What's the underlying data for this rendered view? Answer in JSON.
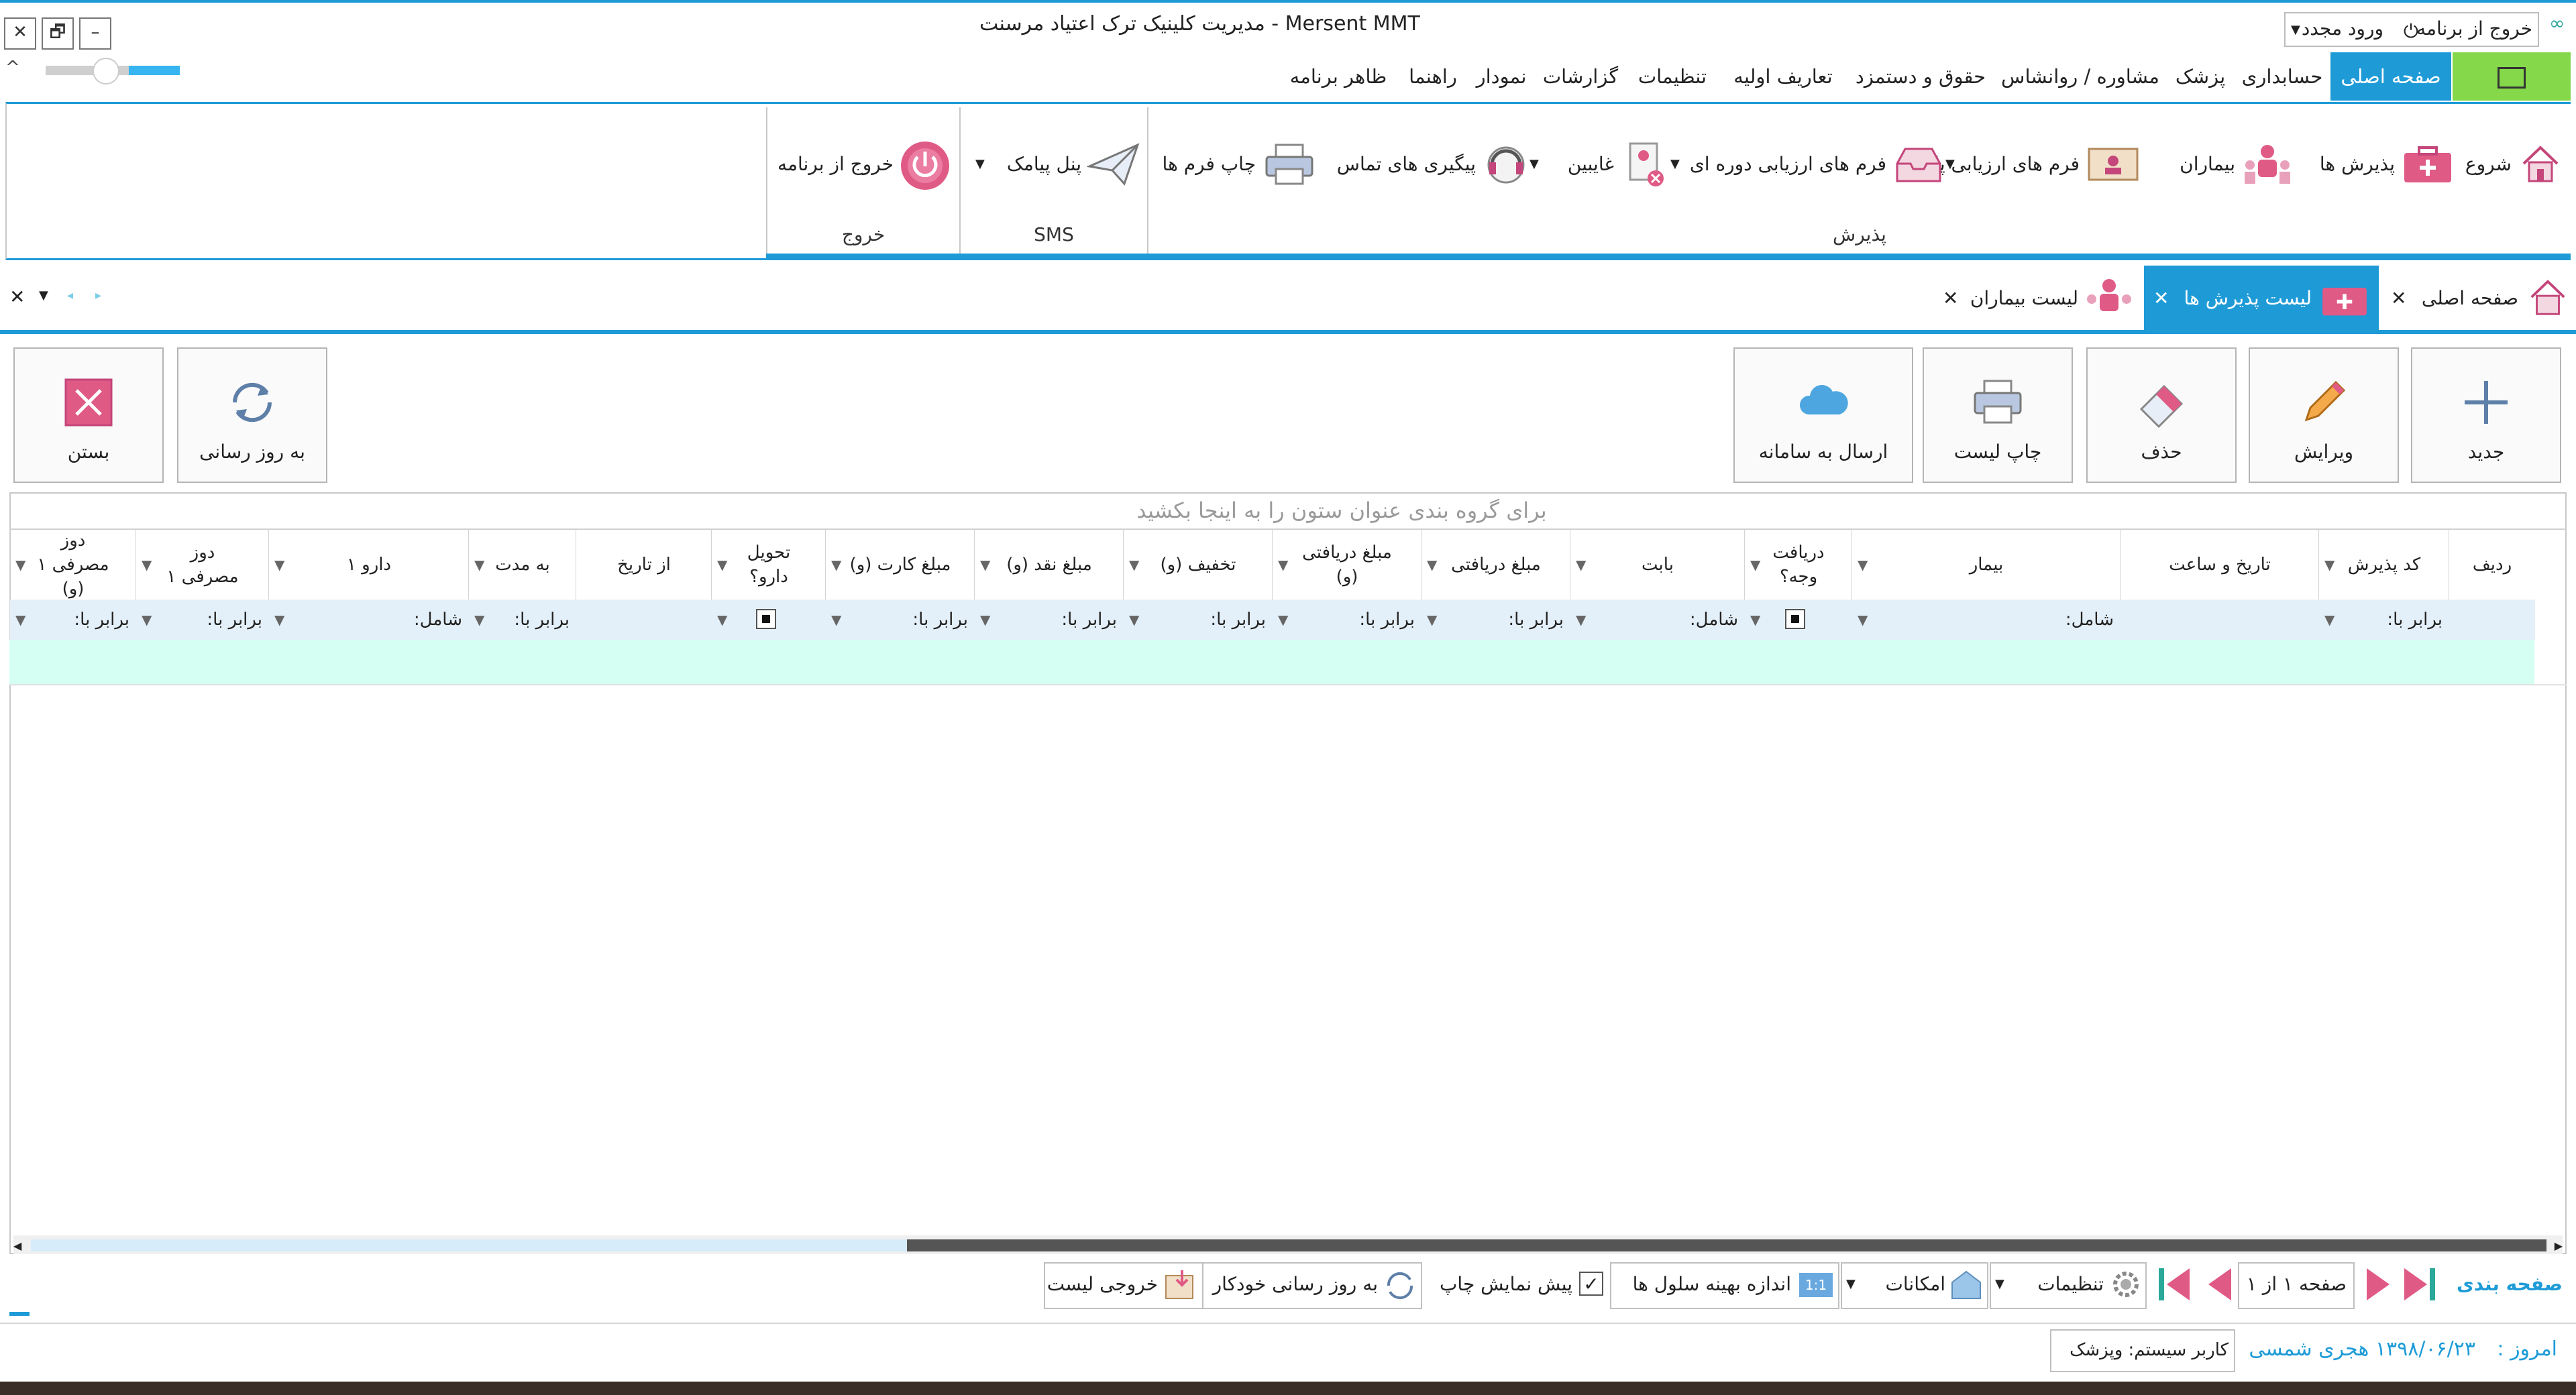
{
  "window": {
    "title": "مدیریت کلینیک ترک اعتیاد مرسنت - Mersent MMT",
    "exit_label": "خروج از برنامه",
    "relogin_label": "ورود مجدد"
  },
  "menu": {
    "tabs": [
      {
        "label": "صفحه اصلی",
        "active": true
      },
      {
        "label": "حسابداری"
      },
      {
        "label": "پزشک"
      },
      {
        "label": "مشاوره / روانشاس"
      },
      {
        "label": "حقوق و دستمزد"
      },
      {
        "label": "تعاریف اولیه"
      },
      {
        "label": "تنظیمات"
      },
      {
        "label": "گزارشات"
      },
      {
        "label": "نمودار"
      },
      {
        "label": "راهنما"
      },
      {
        "label": "ظاهر برنامه"
      }
    ]
  },
  "ribbon": {
    "items": [
      {
        "label": "شروع",
        "icon": "house-icon"
      },
      {
        "label": "پذیرش ها",
        "icon": "medical-case-icon"
      },
      {
        "label": "بیماران",
        "icon": "patients-icon"
      },
      {
        "label": "فرم های ارزیابی پایه",
        "icon": "form-icon"
      },
      {
        "label": "فرم های ارزیابی دوره ای",
        "icon": "inbox-icon"
      },
      {
        "label": "غایبین",
        "icon": "absent-icon"
      },
      {
        "label": "پیگیری های تماس",
        "icon": "headset-icon"
      },
      {
        "label": "چاپ فرم ها",
        "icon": "printer-icon"
      },
      {
        "label": "پنل پیامک",
        "icon": "paper-plane-icon"
      },
      {
        "label": "خروج از برنامه",
        "icon": "power-icon"
      }
    ],
    "groups": {
      "reception": "پذیرش",
      "sms": "SMS",
      "exit": "خروج"
    }
  },
  "doc_tabs": [
    {
      "label": "صفحه اصلی"
    },
    {
      "label": "لیست پذیرش ها",
      "active": true
    },
    {
      "label": "لیست بیماران"
    }
  ],
  "toolbar": {
    "new": "جدید",
    "edit": "ویرایش",
    "delete": "حذف",
    "print_list": "چاپ لیست",
    "send": "ارسال به سامانه",
    "refresh": "به روز رسانی",
    "close": "بستن"
  },
  "grid": {
    "group_hint": "برای گروه بندی عنوان ستون را به اینجا بکشید",
    "columns": [
      "ردیف",
      "کد پذیرش",
      "تاریخ و ساعت",
      "بیمار",
      "دریافت وجه؟",
      "بابت",
      "مبلغ دریافتی",
      "مبلغ دریافتی (و)",
      "تخفیف (و)",
      "مبلغ نقد (و)",
      "مبلغ کارت (و)",
      "تحویل دارو؟",
      "از تاریخ",
      "به مدت",
      "دارو ۱",
      "دوز مصرفی ۱",
      "دوز مصرفی ۱ (و)"
    ],
    "filters": {
      "equal": "برابر با:",
      "contains": "شامل:"
    }
  },
  "pager": {
    "label": "صفحه بندی",
    "page_info": "صفحه ۱ از ۱",
    "settings": "تنظیمات",
    "features": "امکانات",
    "optimal_size": "اندازه بهینه سلول ها",
    "print_preview": "پیش نمایش چاپ",
    "auto_refresh": "به روز رسانی خودکار",
    "export": "خروجی لیست"
  },
  "status": {
    "today_label": "امروز :",
    "today_value": "۱۳۹۸/۰۶/۲۳ هجری شمسی",
    "user": "کاربر سیستم: وپزشک"
  },
  "colors": {
    "accent": "#1e9bd7",
    "green": "#84d84a",
    "pink": "#e05a86",
    "row_highlight": "#d4fff2"
  }
}
